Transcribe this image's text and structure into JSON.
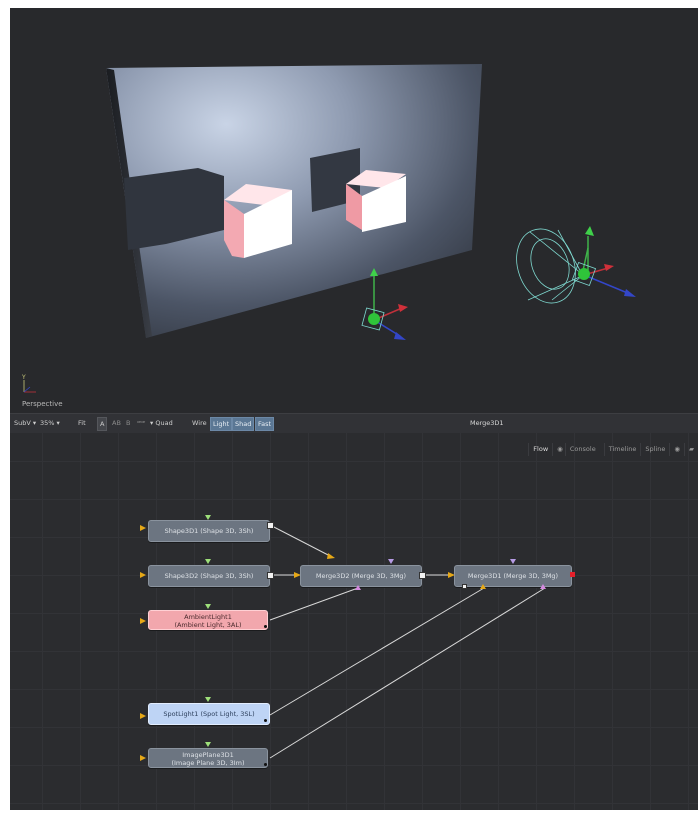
{
  "viewer": {
    "view_label": "Perspective",
    "axis_label": "Y"
  },
  "toolbar": {
    "subv": "SubV",
    "subv_arrow": "▾",
    "zoom": "35%",
    "zoom_arrow": "▾",
    "fit": "Fit",
    "btn_a": "A",
    "btn_ab": "AB",
    "btn_b": "B",
    "btn_stereo": "ꟹꟹ",
    "quad_arrow": "▾",
    "quad": "Quad",
    "wire": "Wire",
    "light": "Light",
    "shad": "Shad",
    "fast": "Fast",
    "title": "Merge3D1"
  },
  "flow_tabs": {
    "flow": "Flow",
    "console": "Console",
    "timeline": "Timeline",
    "spline": "Spline"
  },
  "nodes": {
    "shape1": "Shape3D1  (Shape 3D, 3Sh)",
    "shape2": "Shape3D2  (Shape 3D, 3Sh)",
    "ambient_l1": "AmbientLight1",
    "ambient_l2": "(Ambient Light, 3AL)",
    "spot": "SpotLight1  (Spot Light, 3SL)",
    "imageplane_l1": "ImagePlane3D1",
    "imageplane_l2": "(Image Plane 3D, 3Im)",
    "merge2": "Merge3D2  (Merge 3D, 3Mg)",
    "merge1": "Merge3D1  (Merge 3D, 3Mg)"
  },
  "colors": {
    "ambient_node": "#f2a7ad",
    "spot_node": "#bed4f5",
    "default_node": "#6c7581",
    "wire": "#d8d8d8",
    "input_port": "#e6a817"
  }
}
